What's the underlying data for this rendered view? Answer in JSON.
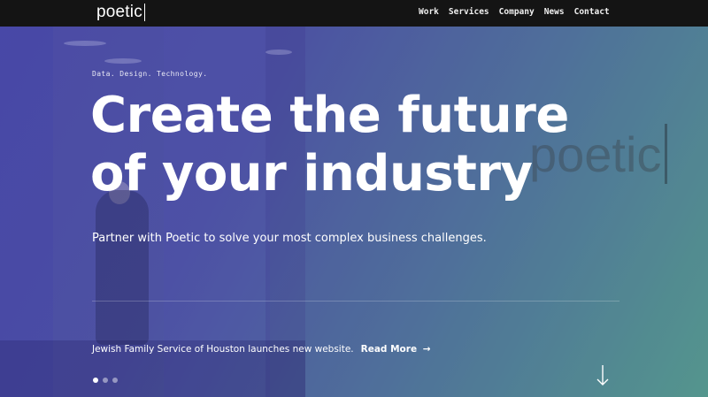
{
  "header": {
    "logo": "poetic",
    "nav": [
      "Work",
      "Services",
      "Company",
      "News",
      "Contact"
    ]
  },
  "hero": {
    "eyebrow": "Data. Design. Technology.",
    "headline_line1": "Create the future",
    "headline_line2": "of your industry",
    "watermark": "poetic",
    "subtitle": "Partner with Poetic to solve your most complex business challenges.",
    "news_text": "Jewish Family Service of Houston launches new website.",
    "read_more": "Read More",
    "read_more_arrow": "→"
  },
  "slider": {
    "slide_count": 3,
    "active_index": 0
  },
  "icons": {
    "scroll": "arrow-down-icon",
    "read_more": "arrow-right-icon"
  },
  "colors": {
    "topbar": "#141414",
    "gradient_start": "#4b4aa6",
    "gradient_end": "#56a08a",
    "text": "#ffffff"
  }
}
